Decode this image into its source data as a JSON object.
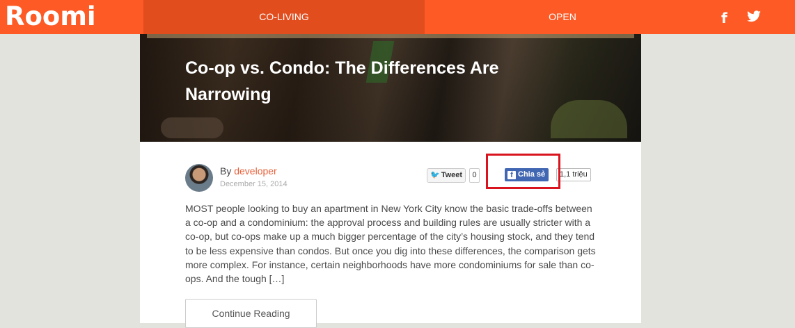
{
  "header": {
    "logo": "Roomi",
    "nav": [
      {
        "label": "CO-LIVING"
      },
      {
        "label": "OPEN"
      }
    ],
    "social": {
      "facebook_icon": "facebook-icon",
      "twitter_icon": "twitter-icon"
    }
  },
  "post": {
    "title": "Co-op vs. Condo: The Differences Are Narrowing",
    "by_prefix": "By",
    "author": "developer",
    "date": "December 15, 2014",
    "excerpt": "MOST people looking to buy an apartment in New York City know the basic trade-offs between a co-op and a condominium: the approval process and building rules are usually stricter with a co-op, but co-ops make up a much bigger percentage of the city’s housing stock, and they tend to be less expensive than condos. But once you dig into these differences, the comparison gets more complex. For instance, certain neighborhoods have more condominiums for sale than co-ops. And the tough […]",
    "continue_label": "Continue Reading"
  },
  "share": {
    "tweet_label": "Tweet",
    "tweet_count": "0",
    "fb_label": "Chia sẻ",
    "fb_count": "1,1 triệu"
  },
  "colors": {
    "brand_orange": "#fd5a25",
    "nav_active": "#e24d1e",
    "author_link": "#e8603a",
    "highlight": "#d9141e",
    "facebook_blue": "#4267b2"
  }
}
